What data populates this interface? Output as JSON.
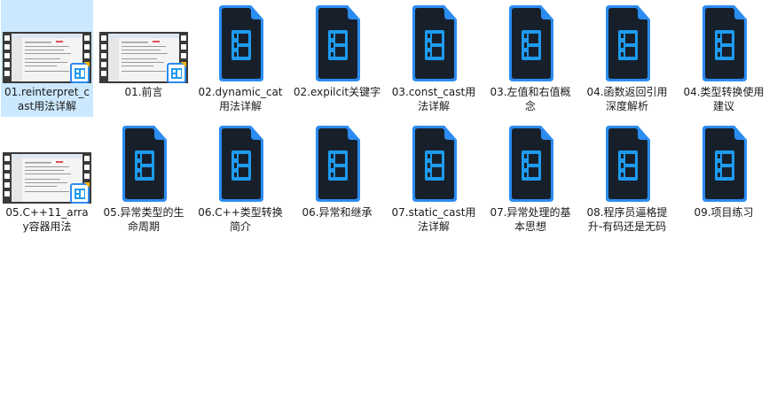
{
  "files": [
    {
      "name": "01.reinterpret_cast用法详解",
      "thumb": "film",
      "selected": true
    },
    {
      "name": "01.前言",
      "thumb": "film",
      "selected": false
    },
    {
      "name": "02.dynamic_cat用法详解",
      "thumb": "icon"
    },
    {
      "name": "02.expilcit关键字",
      "thumb": "icon"
    },
    {
      "name": "03.const_cast用法详解",
      "thumb": "icon"
    },
    {
      "name": "03.左值和右值概念",
      "thumb": "icon"
    },
    {
      "name": "04.函数返回引用深度解析",
      "thumb": "icon"
    },
    {
      "name": "04.类型转换使用建议",
      "thumb": "icon"
    },
    {
      "name": "05.C++11_array容器用法",
      "thumb": "film"
    },
    {
      "name": "05.异常类型的生命周期",
      "thumb": "icon"
    },
    {
      "name": "06.C++类型转换简介",
      "thumb": "icon"
    },
    {
      "name": "06.异常和继承",
      "thumb": "icon"
    },
    {
      "name": "07.static_cast用法详解",
      "thumb": "icon"
    },
    {
      "name": "07.异常处理的基本思想",
      "thumb": "icon"
    },
    {
      "name": "08.程序员逼格提升-有码还是无码",
      "thumb": "icon"
    },
    {
      "name": "09.项目练习",
      "thumb": "icon"
    }
  ],
  "colors": {
    "selection": "#cce8ff",
    "icon_body": "#17202a",
    "icon_border": "#2b8cf2",
    "icon_glyph": "#1e9bf0"
  }
}
